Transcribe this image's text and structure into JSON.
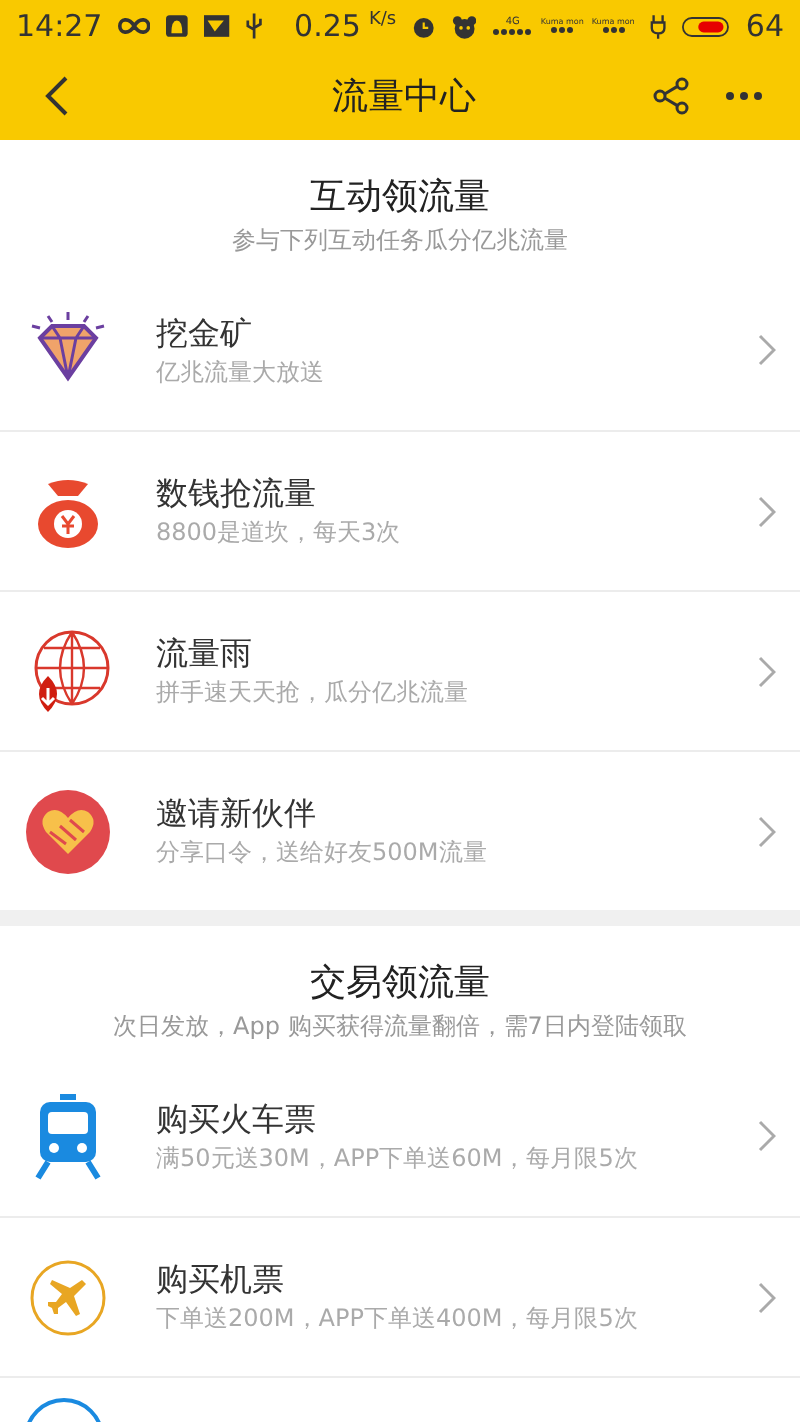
{
  "status_bar": {
    "time": "14:27",
    "speed": "0.25",
    "speed_unit": "K/s",
    "network": "4G",
    "carrier_1": "Kuma mon",
    "carrier_2": "Kuma mon",
    "battery": "64"
  },
  "header": {
    "title": "流量中心"
  },
  "sections": [
    {
      "title": "互动领流量",
      "subtitle": "参与下列互动任务瓜分亿兆流量",
      "items": [
        {
          "kind": "diamond",
          "title": "挖金矿",
          "subtitle": "亿兆流量大放送"
        },
        {
          "kind": "moneybag",
          "title": "数钱抢流量",
          "subtitle": "8800是道坎，每天3次"
        },
        {
          "kind": "globe",
          "title": "流量雨",
          "subtitle": "拼手速天天抢，瓜分亿兆流量"
        },
        {
          "kind": "handshake",
          "title": "邀请新伙伴",
          "subtitle": "分享口令，送给好友500M流量"
        }
      ]
    },
    {
      "title": "交易领流量",
      "subtitle": "次日发放，App 购买获得流量翻倍，需7日内登陆领取",
      "items": [
        {
          "kind": "train",
          "title": "购买火车票",
          "subtitle": "满50元送30M，APP下单送60M，每月限5次"
        },
        {
          "kind": "plane",
          "title": "购买机票",
          "subtitle": "下单送200M，APP下单送400M，每月限5次"
        },
        {
          "kind": "partial"
        }
      ]
    }
  ]
}
